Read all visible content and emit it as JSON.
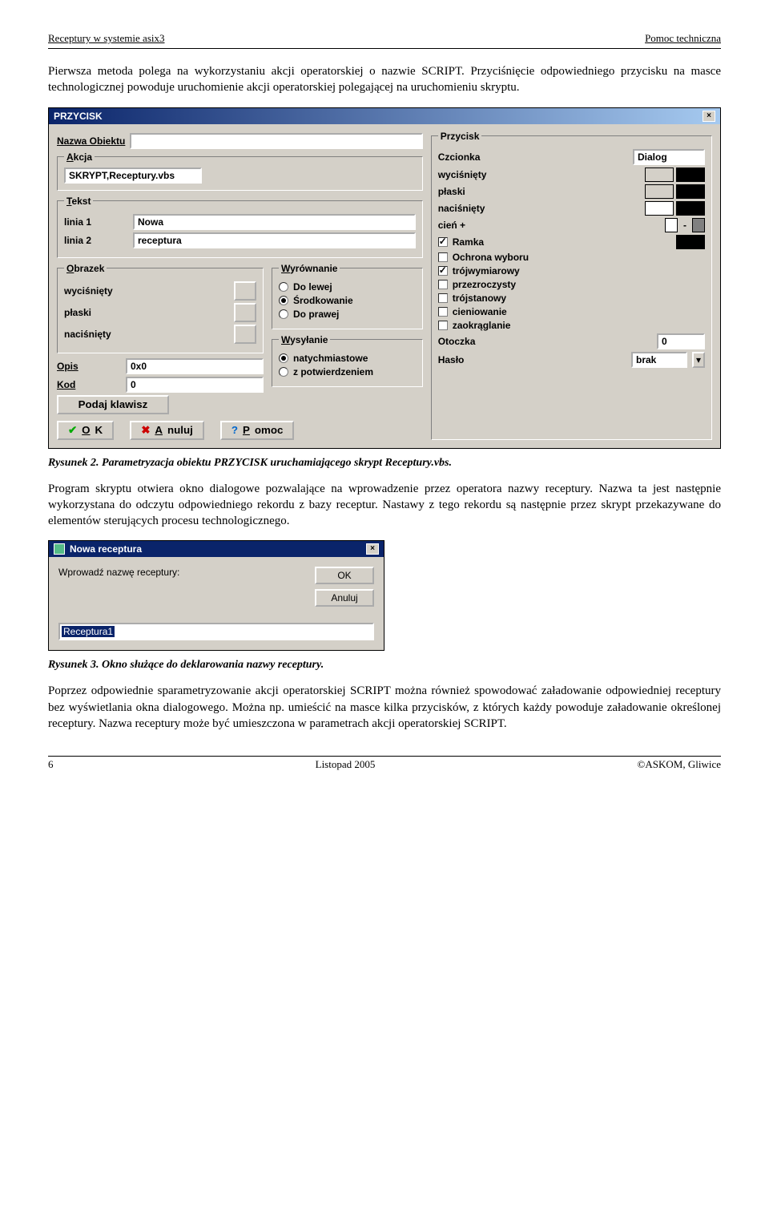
{
  "header": {
    "left": "Receptury w systemie asix3",
    "right": "Pomoc techniczna"
  },
  "para1": "Pierwsza metoda polega na wykorzystaniu akcji operatorskiej o nazwie SCRIPT. Przyciśnięcie odpowiedniego przycisku na masce technologicznej powoduje uruchomienie akcji operatorskiej polegającej na uruchomieniu skryptu.",
  "dlg1": {
    "title": "PRZYCISK",
    "nazwa_label": "Nazwa Obiektu",
    "nazwa_value": "",
    "akcja_legend": "Akcja",
    "akcja_value": "SKRYPT,Receptury.vbs",
    "tekst_legend": "Tekst",
    "linia1_label": "linia 1",
    "linia1_value": "Nowa",
    "linia2_label": "linia 2",
    "linia2_value": "receptura",
    "obrazek_legend": "Obrazek",
    "obrazek_items": [
      "wyciśnięty",
      "płaski",
      "naciśnięty"
    ],
    "wyrownanie_legend": "Wyrównanie",
    "wyrownanie_items": [
      "Do lewej",
      "Środkowanie",
      "Do prawej"
    ],
    "wyrownanie_selected": 1,
    "wysylanie_legend": "Wysyłanie",
    "wysylanie_items": [
      "natychmiastowe",
      "z potwierdzeniem"
    ],
    "wysylanie_selected": 0,
    "opis_label": "Opis",
    "opis_value": "0x0",
    "kod_label": "Kod",
    "kod_value": "0",
    "podaj_klawisz": "Podaj klawisz",
    "przycisk_legend": "Przycisk",
    "czcionka_label": "Czcionka",
    "czcionka_value": "Dialog",
    "wycisniety": "wyciśnięty",
    "plaski": "płaski",
    "nacisniety": "naciśnięty",
    "cien_label": "cień +",
    "cien_minus": "-",
    "ramka": "Ramka",
    "ochrona": "Ochrona wyboru",
    "trojwym": "trójwymiarowy",
    "przezr": "przezroczysty",
    "trojst": "trójstanowy",
    "cien": "cieniowanie",
    "zaokr": "zaokrąglanie",
    "otoczka_label": "Otoczka",
    "otoczka_value": "0",
    "haslo_label": "Hasło",
    "haslo_value": "brak",
    "ok": "OK",
    "anuluj": "Anuluj",
    "pomoc": "Pomoc",
    "colors": {
      "wyc1": "#d4d0c8",
      "wyc2": "#000000",
      "pla1": "#d4d0c8",
      "pla2": "#000000",
      "nac1": "#ffffff",
      "nac2": "#000000",
      "cienp": "#ffffff",
      "cienm": "#808080",
      "ramka": "#000000"
    }
  },
  "caption1": "Rysunek 2. Parametryzacja obiektu PRZYCISK uruchamiającego skrypt Receptury.vbs.",
  "para2": "Program skryptu otwiera okno dialogowe pozwalające na wprowadzenie przez operatora nazwy receptury. Nazwa ta jest następnie wykorzystana do odczytu odpowiedniego rekordu z  bazy  receptur.  Nastawy  z  tego  rekordu  są  następnie  przez  skrypt  przekazywane  do elementów sterujących procesu technologicznego.",
  "dlg2": {
    "title": "Nowa receptura",
    "prompt": "Wprowadź nazwę receptury:",
    "ok": "OK",
    "cancel": "Anuluj",
    "value": "Receptura1"
  },
  "caption2": "Rysunek 3. Okno służące do deklarowania nazwy receptury.",
  "para3": "Poprzez odpowiednie sparametryzowanie akcji operatorskiej SCRIPT można również spowodować załadowanie odpowiedniej receptury bez wyświetlania okna dialogowego. Można np. umieścić na masce kilka przycisków, z których każdy powoduje załadowanie określonej receptury. Nazwa receptury może być umieszczona w parametrach akcji operatorskiej SCRIPT.",
  "footer": {
    "left": "6",
    "center": "Listopad 2005",
    "right": "©ASKOM, Gliwice"
  }
}
